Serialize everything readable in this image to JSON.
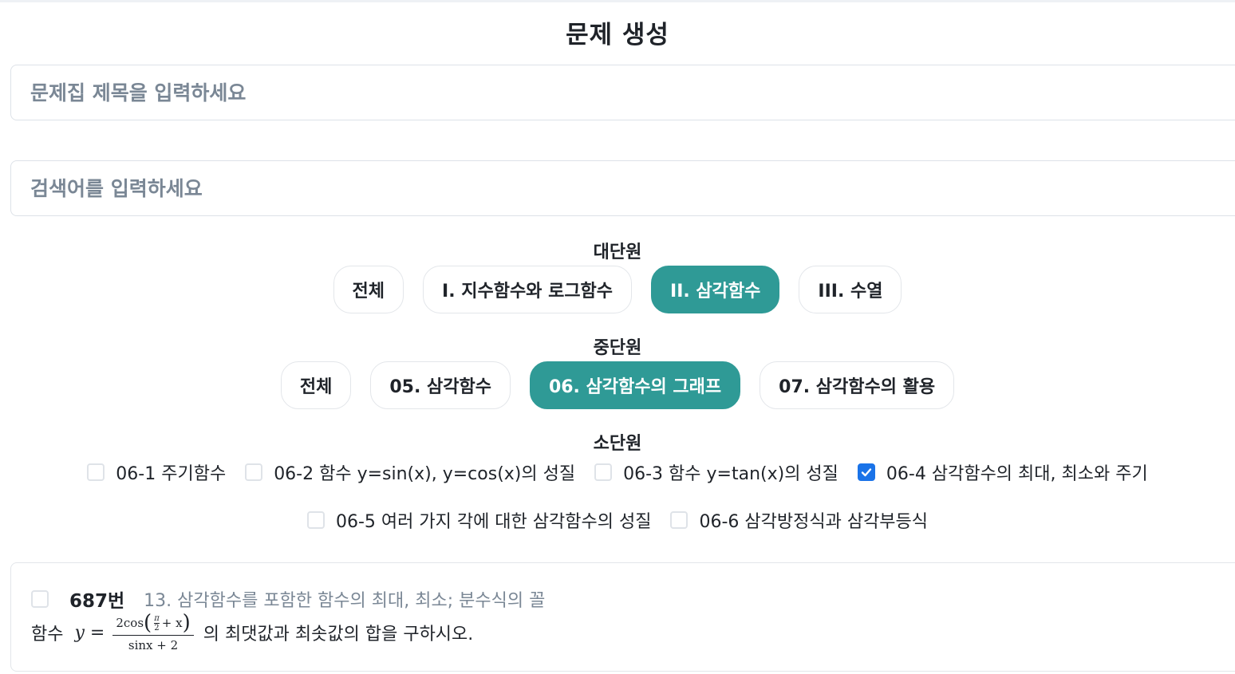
{
  "page": {
    "title": "문제 생성"
  },
  "inputs": {
    "title_placeholder": "문제집 제목을 입력하세요",
    "search_placeholder": "검색어를 입력하세요"
  },
  "major_units": {
    "label": "대단원",
    "items": [
      "전체",
      "I. 지수함수와 로그함수",
      "II. 삼각함수",
      "III. 수열"
    ],
    "selected": "II. 삼각함수"
  },
  "middle_units": {
    "label": "중단원",
    "items": [
      "전체",
      "05. 삼각함수",
      "06. 삼각함수의 그래프",
      "07. 삼각함수의 활용"
    ],
    "selected": "06. 삼각함수의 그래프"
  },
  "minor_units": {
    "label": "소단원",
    "items": [
      {
        "label": "06-1 주기함수",
        "checked": false
      },
      {
        "label": "06-2 함수 y=sin(x), y=cos(x)의 성질",
        "checked": false
      },
      {
        "label": "06-3 함수 y=tan(x)의 성질",
        "checked": false
      },
      {
        "label": "06-4 삼각함수의 최대, 최소와 주기",
        "checked": true
      },
      {
        "label": "06-5 여러 가지 각에 대한 삼각함수의 성질",
        "checked": false
      },
      {
        "label": "06-6 삼각방정식과 삼각부등식",
        "checked": false
      }
    ]
  },
  "problem": {
    "number": "687번",
    "topic": "13. 삼각함수를 포함한 함수의 최대, 최소; 분수식의 꼴",
    "text_prefix": "함수",
    "math_lhs": "y =",
    "numerator_pre": "2cos",
    "pi": "π",
    "two": "2",
    "numerator_post": "+ x",
    "denominator": "sinx + 2",
    "text_suffix": "의 최댓값과 최솟값의 합을 구하시오.",
    "checked": false
  },
  "colors": {
    "accent": "#2f9a96",
    "checkbox_checked": "#1a73e8",
    "placeholder": "#7a8795"
  }
}
